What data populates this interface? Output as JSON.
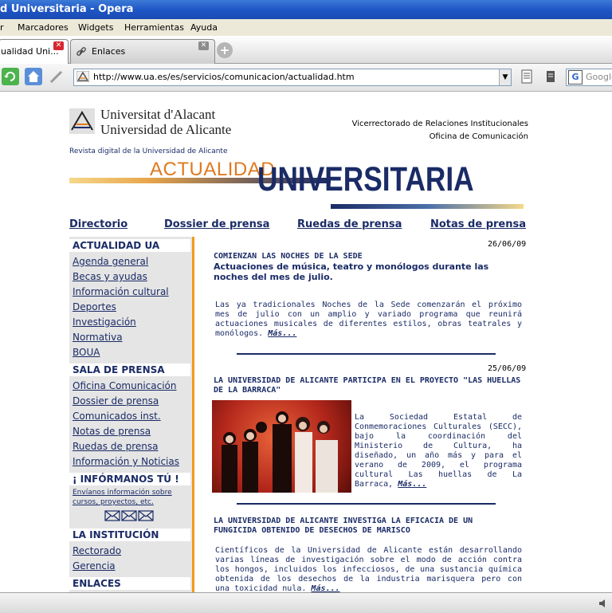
{
  "window": {
    "title": "d Universitaria - Opera"
  },
  "menu": [
    "r",
    "Marcadores",
    "Widgets",
    "Herramientas",
    "Ayuda"
  ],
  "tabs": [
    {
      "label": "ualidad Uni...",
      "active": true
    },
    {
      "label": "Enlaces",
      "active": false
    }
  ],
  "address": {
    "url": "http://www.ua.es/es/servicios/comunicacion/actualidad.htm"
  },
  "search": {
    "placeholder": "Google"
  },
  "header": {
    "uni_va": "Universitat d'Alacant",
    "uni_es": "Universidad de Alicante",
    "vice": "Vicerrectorado de Relaciones Institucionales",
    "oficina": "Oficina de Comunicación",
    "revista": "Revista digital de la Universidad de Alicante",
    "logo_a": "ACTUALIDAD",
    "logo_b": "UNIVERSITARIA"
  },
  "toplinks": [
    "Directorio",
    "Dossier de prensa",
    "Ruedas de prensa",
    "Notas de prensa"
  ],
  "sidebar": {
    "sec1": "ACTUALIDAD UA",
    "items1": [
      "Agenda general",
      "Becas y ayudas",
      "Información cultural",
      "Deportes",
      "Investigación",
      "Normativa",
      "BOUA"
    ],
    "sec2": "SALA DE PRENSA",
    "items2": [
      "Oficina Comunicación",
      "Dossier de prensa",
      "Comunicados inst.",
      "Notas de prensa",
      "Ruedas de prensa",
      "Información y Noticias"
    ],
    "sec3": "¡ INFÓRMANOS TÚ !",
    "inform_1": "Envíanos información sobre",
    "inform_2": "cursos, proyectos, etc.",
    "sec4": "LA INSTITUCIÓN",
    "items4": [
      "Rectorado",
      "Gerencia"
    ],
    "sec5": "ENLACES"
  },
  "articles": [
    {
      "date": "26/06/09",
      "title": "COMIENZAN LAS NOCHES DE LA SEDE",
      "subtitle": "Actuaciones de música, teatro y monólogos durante las noches del mes de julio.",
      "body": "Las ya tradicionales Noches de la Sede comenzarán el próximo mes de julio con un amplio y variado programa que reunirá actuaciones musicales de diferentes estilos, obras teatrales y monólogos.",
      "more": "Más..."
    },
    {
      "date": "25/06/09",
      "title": "LA UNIVERSIDAD DE ALICANTE PARTICIPA EN EL PROYECTO \"LAS HUELLAS DE LA BARRACA\"",
      "body": "La Sociedad Estatal de Conmemoraciones Culturales (SECC), bajo la coordinación del Ministerio de Cultura, ha diseñado, un año más y para el verano de 2009, el programa cultural Las huellas de La Barraca,",
      "more": "Más..."
    },
    {
      "title": "LA UNIVERSIDAD DE ALICANTE INVESTIGA LA EFICACIA DE UN FUNGICIDA OBTENIDO DE DESECHOS DE MARISCO",
      "body": "Científicos de la Universidad de Alicante están desarrollando varias líneas de investigación sobre el modo de acción contra los hongos, incluidos los infecciosos, de una sustancia química obtenida de los desechos de la industria marisquera pero con una toxicidad nula.",
      "more": "Más..."
    }
  ],
  "colors": {
    "navy": "#1a2b66",
    "orange": "#f29a1c",
    "sidebar_bg": "#e5e5e5",
    "logo_orange": "#e07a1f"
  }
}
